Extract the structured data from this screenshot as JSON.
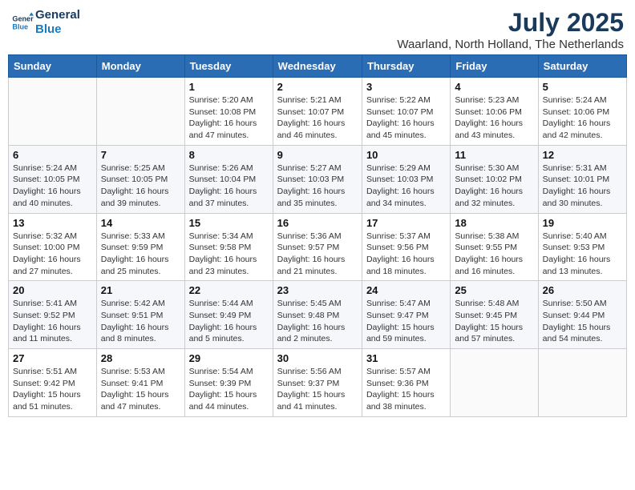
{
  "header": {
    "logo_line1": "General",
    "logo_line2": "Blue",
    "month_year": "July 2025",
    "location": "Waarland, North Holland, The Netherlands"
  },
  "days_of_week": [
    "Sunday",
    "Monday",
    "Tuesday",
    "Wednesday",
    "Thursday",
    "Friday",
    "Saturday"
  ],
  "weeks": [
    [
      {
        "day": "",
        "content": ""
      },
      {
        "day": "",
        "content": ""
      },
      {
        "day": "1",
        "content": "Sunrise: 5:20 AM\nSunset: 10:08 PM\nDaylight: 16 hours and 47 minutes."
      },
      {
        "day": "2",
        "content": "Sunrise: 5:21 AM\nSunset: 10:07 PM\nDaylight: 16 hours and 46 minutes."
      },
      {
        "day": "3",
        "content": "Sunrise: 5:22 AM\nSunset: 10:07 PM\nDaylight: 16 hours and 45 minutes."
      },
      {
        "day": "4",
        "content": "Sunrise: 5:23 AM\nSunset: 10:06 PM\nDaylight: 16 hours and 43 minutes."
      },
      {
        "day": "5",
        "content": "Sunrise: 5:24 AM\nSunset: 10:06 PM\nDaylight: 16 hours and 42 minutes."
      }
    ],
    [
      {
        "day": "6",
        "content": "Sunrise: 5:24 AM\nSunset: 10:05 PM\nDaylight: 16 hours and 40 minutes."
      },
      {
        "day": "7",
        "content": "Sunrise: 5:25 AM\nSunset: 10:05 PM\nDaylight: 16 hours and 39 minutes."
      },
      {
        "day": "8",
        "content": "Sunrise: 5:26 AM\nSunset: 10:04 PM\nDaylight: 16 hours and 37 minutes."
      },
      {
        "day": "9",
        "content": "Sunrise: 5:27 AM\nSunset: 10:03 PM\nDaylight: 16 hours and 35 minutes."
      },
      {
        "day": "10",
        "content": "Sunrise: 5:29 AM\nSunset: 10:03 PM\nDaylight: 16 hours and 34 minutes."
      },
      {
        "day": "11",
        "content": "Sunrise: 5:30 AM\nSunset: 10:02 PM\nDaylight: 16 hours and 32 minutes."
      },
      {
        "day": "12",
        "content": "Sunrise: 5:31 AM\nSunset: 10:01 PM\nDaylight: 16 hours and 30 minutes."
      }
    ],
    [
      {
        "day": "13",
        "content": "Sunrise: 5:32 AM\nSunset: 10:00 PM\nDaylight: 16 hours and 27 minutes."
      },
      {
        "day": "14",
        "content": "Sunrise: 5:33 AM\nSunset: 9:59 PM\nDaylight: 16 hours and 25 minutes."
      },
      {
        "day": "15",
        "content": "Sunrise: 5:34 AM\nSunset: 9:58 PM\nDaylight: 16 hours and 23 minutes."
      },
      {
        "day": "16",
        "content": "Sunrise: 5:36 AM\nSunset: 9:57 PM\nDaylight: 16 hours and 21 minutes."
      },
      {
        "day": "17",
        "content": "Sunrise: 5:37 AM\nSunset: 9:56 PM\nDaylight: 16 hours and 18 minutes."
      },
      {
        "day": "18",
        "content": "Sunrise: 5:38 AM\nSunset: 9:55 PM\nDaylight: 16 hours and 16 minutes."
      },
      {
        "day": "19",
        "content": "Sunrise: 5:40 AM\nSunset: 9:53 PM\nDaylight: 16 hours and 13 minutes."
      }
    ],
    [
      {
        "day": "20",
        "content": "Sunrise: 5:41 AM\nSunset: 9:52 PM\nDaylight: 16 hours and 11 minutes."
      },
      {
        "day": "21",
        "content": "Sunrise: 5:42 AM\nSunset: 9:51 PM\nDaylight: 16 hours and 8 minutes."
      },
      {
        "day": "22",
        "content": "Sunrise: 5:44 AM\nSunset: 9:49 PM\nDaylight: 16 hours and 5 minutes."
      },
      {
        "day": "23",
        "content": "Sunrise: 5:45 AM\nSunset: 9:48 PM\nDaylight: 16 hours and 2 minutes."
      },
      {
        "day": "24",
        "content": "Sunrise: 5:47 AM\nSunset: 9:47 PM\nDaylight: 15 hours and 59 minutes."
      },
      {
        "day": "25",
        "content": "Sunrise: 5:48 AM\nSunset: 9:45 PM\nDaylight: 15 hours and 57 minutes."
      },
      {
        "day": "26",
        "content": "Sunrise: 5:50 AM\nSunset: 9:44 PM\nDaylight: 15 hours and 54 minutes."
      }
    ],
    [
      {
        "day": "27",
        "content": "Sunrise: 5:51 AM\nSunset: 9:42 PM\nDaylight: 15 hours and 51 minutes."
      },
      {
        "day": "28",
        "content": "Sunrise: 5:53 AM\nSunset: 9:41 PM\nDaylight: 15 hours and 47 minutes."
      },
      {
        "day": "29",
        "content": "Sunrise: 5:54 AM\nSunset: 9:39 PM\nDaylight: 15 hours and 44 minutes."
      },
      {
        "day": "30",
        "content": "Sunrise: 5:56 AM\nSunset: 9:37 PM\nDaylight: 15 hours and 41 minutes."
      },
      {
        "day": "31",
        "content": "Sunrise: 5:57 AM\nSunset: 9:36 PM\nDaylight: 15 hours and 38 minutes."
      },
      {
        "day": "",
        "content": ""
      },
      {
        "day": "",
        "content": ""
      }
    ]
  ]
}
